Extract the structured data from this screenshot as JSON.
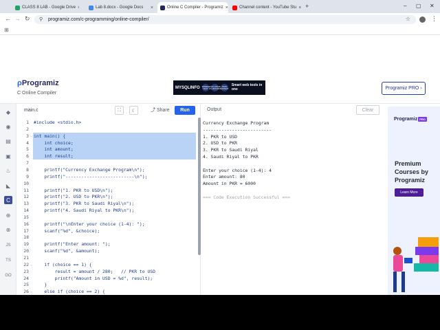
{
  "browser": {
    "tabs": [
      {
        "title": "CLASS 8 LAB - Google Drive",
        "color": "#1fa463"
      },
      {
        "title": "Lab 8.docx - Google Docs",
        "color": "#4285f4"
      },
      {
        "title": "Online C Compiler - Programiz",
        "color": "#25265e"
      },
      {
        "title": "Channel content - YouTube Stu",
        "color": "#ff0000"
      }
    ],
    "new_tab": "+",
    "url": "programiz.com/c-programming/online-compiler/"
  },
  "site": {
    "logo_text": "Programiz",
    "subtitle": "C Online Compiler",
    "ad": {
      "brand": "MYSQLINFO",
      "badges": [
        "SPEED TEST",
        "EXCLUSIVE IP HISTORY",
        "JSON EXPERT"
      ],
      "tagline": "Smart web tools in one"
    },
    "pro_button": "Programiz PRO ›"
  },
  "rail_icons": [
    "python-icon",
    "r-icon",
    "sql-icon",
    "html-icon",
    "java-icon",
    "kotlin-icon",
    "c-icon",
    "cpp-icon",
    "csharp-icon",
    "js-icon",
    "ts-icon",
    "go-icon"
  ],
  "rail_labels": {
    "js": "JS",
    "ts": "TS",
    "go": "GO"
  },
  "editor": {
    "file_name": "main.c",
    "share_label": "Share",
    "run_label": "Run",
    "lines": [
      {
        "n": "1",
        "text": "#include <stdio.h>"
      },
      {
        "n": "2",
        "text": ""
      },
      {
        "n": "3",
        "text": "int main() {",
        "fold": true
      },
      {
        "n": "4",
        "text": "    int choice;"
      },
      {
        "n": "5",
        "text": "    int amount;"
      },
      {
        "n": "6",
        "text": "    int result;"
      },
      {
        "n": "7",
        "text": ""
      },
      {
        "n": "8",
        "text": "    printf(\"Currency Exchange Program\\n\");"
      },
      {
        "n": "9",
        "text": "    printf(\"--------------------------\\n\");"
      },
      {
        "n": "10",
        "text": ""
      },
      {
        "n": "11",
        "text": "    printf(\"1. PKR to USD\\n\");"
      },
      {
        "n": "12",
        "text": "    printf(\"2. USD to PKR\\n\");"
      },
      {
        "n": "13",
        "text": "    printf(\"3. PKR to Saudi Riyal\\n\");"
      },
      {
        "n": "14",
        "text": "    printf(\"4. Saudi Riyal to PKR\\n\");"
      },
      {
        "n": "15",
        "text": ""
      },
      {
        "n": "16",
        "text": "    printf(\"\\nEnter your choice (1-4): \");"
      },
      {
        "n": "17",
        "text": "    scanf(\"%d\", &choice);"
      },
      {
        "n": "18",
        "text": ""
      },
      {
        "n": "19",
        "text": "    printf(\"Enter amount: \");"
      },
      {
        "n": "20",
        "text": "    scanf(\"%d\", &amount);"
      },
      {
        "n": "21",
        "text": ""
      },
      {
        "n": "22",
        "text": "    if (choice == 1) {",
        "fold": true
      },
      {
        "n": "23",
        "text": "        result = amount / 280;   // PKR to USD"
      },
      {
        "n": "24",
        "text": "        printf(\"Amount in USD = %d\", result);"
      },
      {
        "n": "25",
        "text": "    }"
      },
      {
        "n": "26",
        "text": "    else if (choice == 2) {",
        "fold": true
      }
    ]
  },
  "output": {
    "header": "Output",
    "clear_label": "Clear",
    "lines": [
      "Currency Exchange Program",
      "--------------------------",
      "1. PKR to USD",
      "2. USD to PKR",
      "3. PKR to Saudi Riyal",
      "4. Saudi Riyal to PKR",
      "",
      "Enter your choice (1-4): 4",
      "Enter amount: 80",
      "Amount in PKR = 6000",
      "",
      "=== Code Execution Successful ==="
    ]
  },
  "side_ad": {
    "logo": "Programiz",
    "badge": "PRO",
    "headline": "Premium Courses by Programiz",
    "cta": "Learn More"
  }
}
